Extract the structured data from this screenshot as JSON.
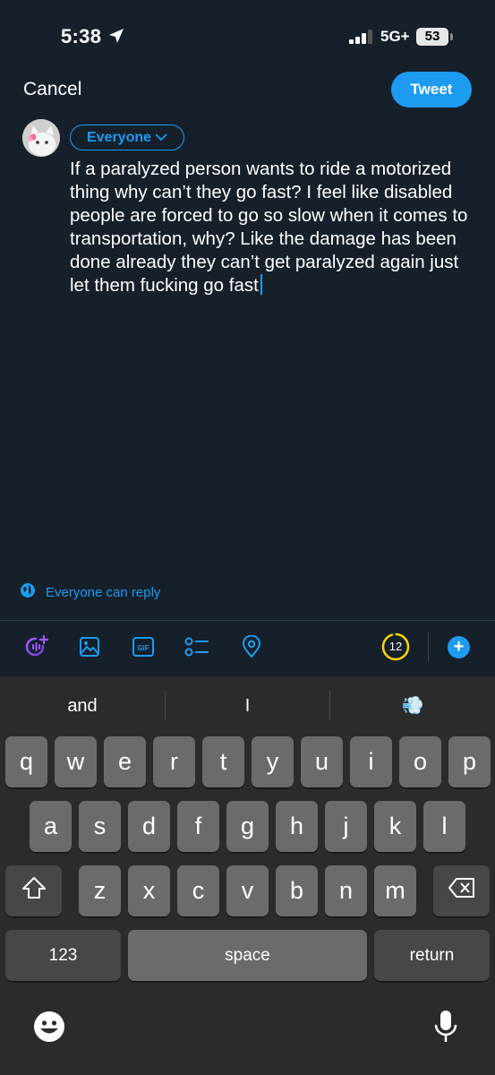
{
  "status_bar": {
    "time": "5:38",
    "network": "5G+",
    "battery": "53"
  },
  "header": {
    "cancel_label": "Cancel",
    "tweet_label": "Tweet"
  },
  "composer": {
    "audience_label": "Everyone",
    "text": "If a paralyzed person wants to ride a motorized thing why can’t they go fast? I feel like disabled people are forced to go so slow when it comes to transportation, why? Like the damage has been done already they can’t get paralyzed again just let them fucking go fast"
  },
  "reply_setting": "Everyone can reply",
  "toolbar": {
    "icons": [
      "spaces-icon",
      "image-icon",
      "gif-icon",
      "poll-icon",
      "location-icon"
    ],
    "char_counter": "12",
    "counter_progress": 0.96
  },
  "keyboard": {
    "suggestions": [
      "and",
      "I",
      "💨"
    ],
    "row1": [
      "q",
      "w",
      "e",
      "r",
      "t",
      "y",
      "u",
      "i",
      "o",
      "p"
    ],
    "row2": [
      "a",
      "s",
      "d",
      "f",
      "g",
      "h",
      "j",
      "k",
      "l"
    ],
    "row3": [
      "z",
      "x",
      "c",
      "v",
      "b",
      "n",
      "m"
    ],
    "numbers_label": "123",
    "space_label": "space",
    "return_label": "return"
  },
  "colors": {
    "background": "#15202b",
    "accent": "#1d9bf0",
    "counter_ring": "#ffd400"
  }
}
